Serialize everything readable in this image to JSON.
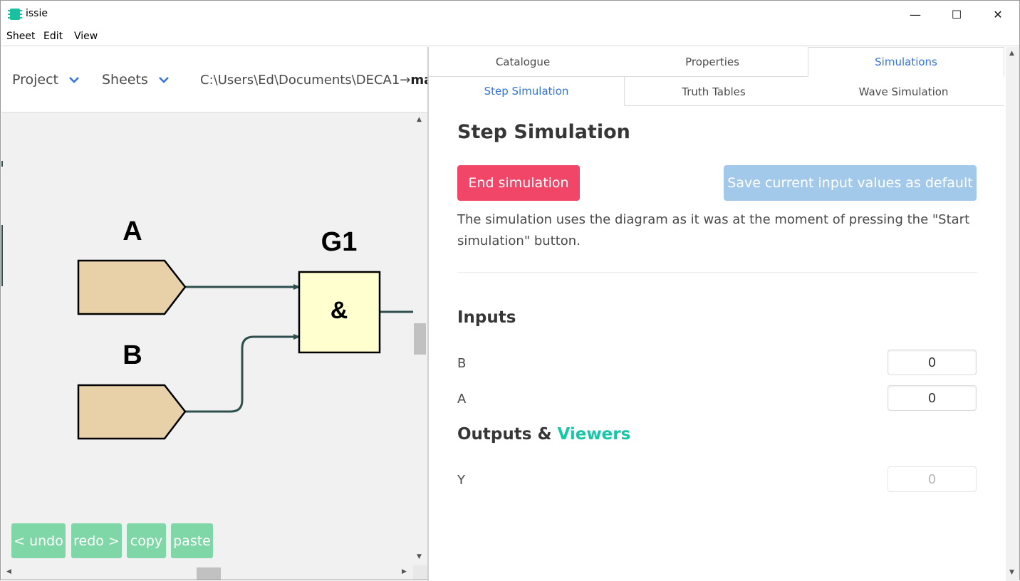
{
  "window": {
    "title": "issie",
    "minimize": "—",
    "maximize": "☐",
    "close": "✕"
  },
  "menu": [
    "Sheet",
    "Edit",
    "View"
  ],
  "topbar": {
    "project_label": "Project",
    "sheets_label": "Sheets",
    "path_prefix": "C:\\Users\\Ed\\Documents\\DECA1→",
    "path_bold": "ma"
  },
  "diagram": {
    "input_a": "A",
    "input_b": "B",
    "gate_label": "G1",
    "gate_symbol": "&"
  },
  "edit_buttons": {
    "undo": "< undo",
    "redo": "redo >",
    "copy": "copy",
    "paste": "paste"
  },
  "tabs": {
    "top": [
      {
        "label": "Catalogue",
        "active": false
      },
      {
        "label": "Properties",
        "active": false
      },
      {
        "label": "Simulations",
        "active": true
      }
    ],
    "sub": [
      {
        "label": "Step Simulation",
        "active": true
      },
      {
        "label": "Truth Tables",
        "active": false
      },
      {
        "label": "Wave Simulation",
        "active": false
      }
    ]
  },
  "sim": {
    "title": "Step Simulation",
    "end_button": "End simulation",
    "save_button": "Save current input values as default",
    "description": "The simulation uses the diagram as it was at the moment of pressing the \"Start simulation\" button.",
    "inputs_heading": "Inputs",
    "inputs": [
      {
        "name": "B",
        "value": "0"
      },
      {
        "name": "A",
        "value": "0"
      }
    ],
    "outputs_heading_prefix": "Outputs & ",
    "outputs_heading_link": "Viewers",
    "outputs": [
      {
        "name": "Y",
        "value": "0"
      }
    ]
  },
  "colors": {
    "accent_blue": "#3273dc",
    "danger": "#f14668",
    "save_disabled": "#a3c9ea",
    "teal": "#16c6a8",
    "edit_button": "#7fd6a6",
    "input_block": "#e8d1a8",
    "gate_fill": "#ffffd0",
    "wire": "#2f4f4f"
  }
}
